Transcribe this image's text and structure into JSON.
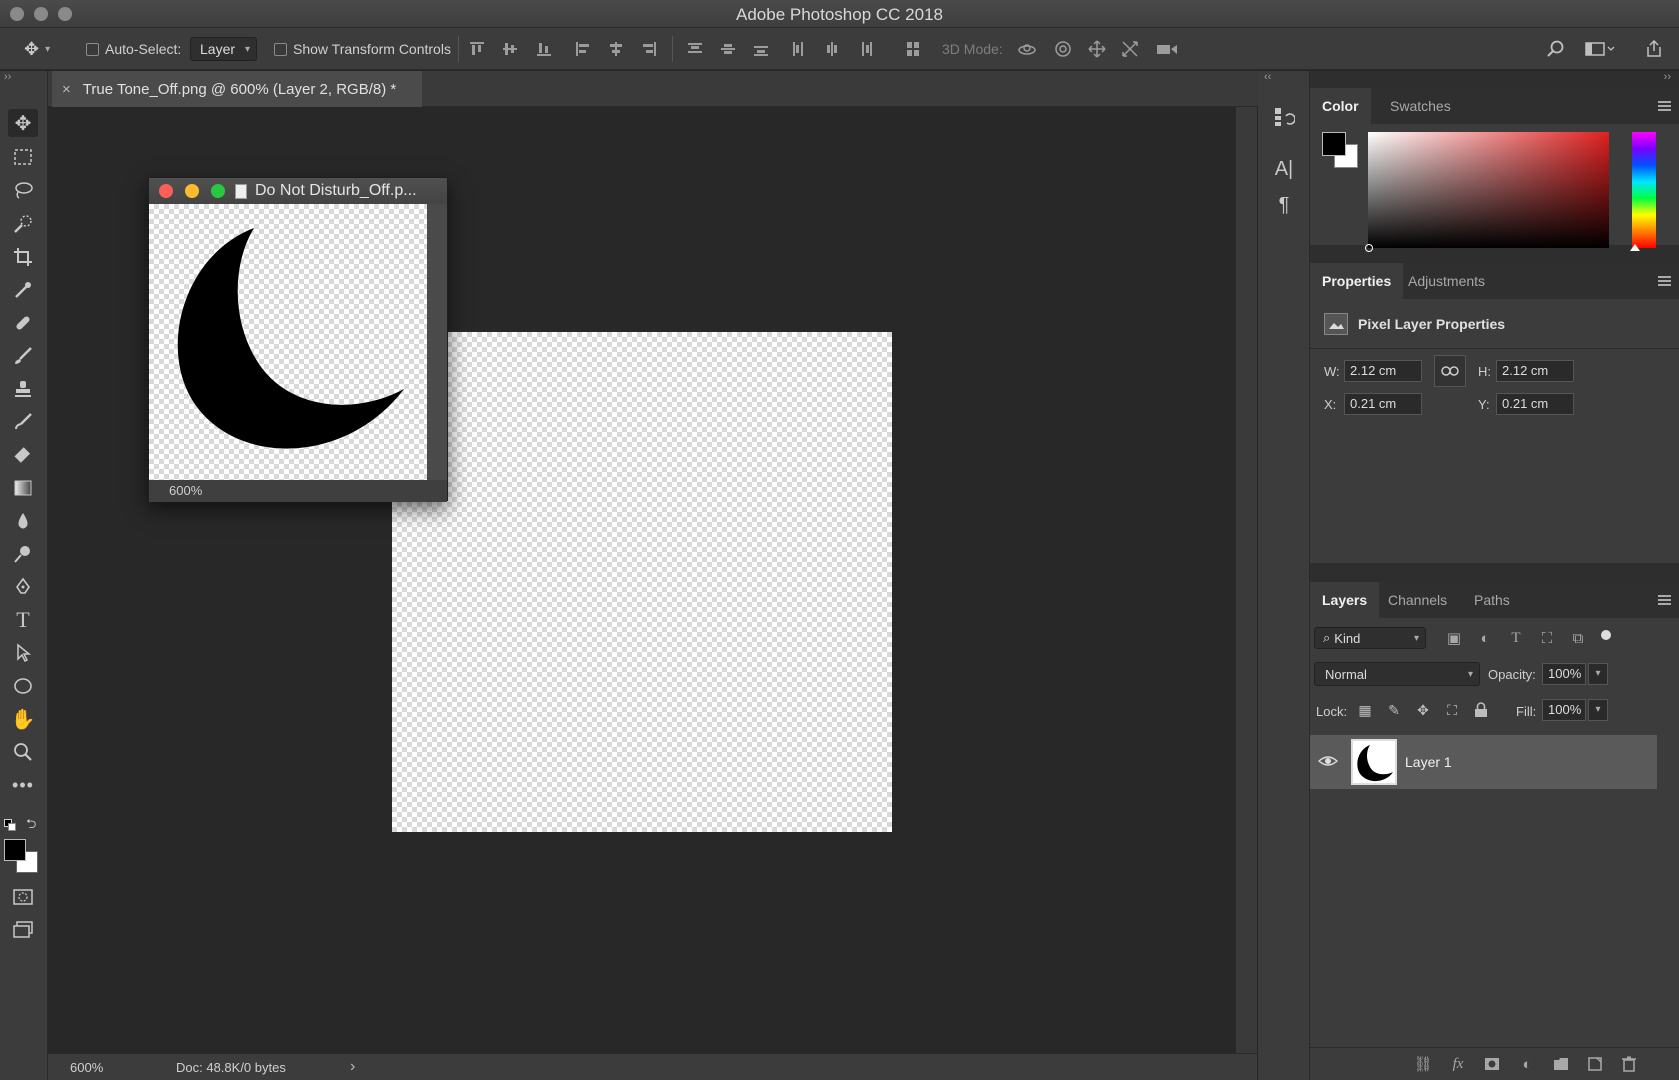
{
  "window": {
    "title": "Adobe Photoshop CC 2018"
  },
  "options_bar": {
    "auto_select_label": "Auto-Select:",
    "auto_select_value": "Layer",
    "show_transform_controls_label": "Show Transform Controls",
    "mode_3d_label": "3D Mode:"
  },
  "document": {
    "tab_title": "True Tone_Off.png @ 600% (Layer 2, RGB/8) *",
    "close_glyph": "×"
  },
  "floating_window": {
    "title": "Do Not Disturb_Off.p...",
    "zoom": "600%"
  },
  "status_bar": {
    "zoom": "600%",
    "doc_info": "Doc: 48.8K/0 bytes",
    "arrow": "›"
  },
  "color_panel": {
    "tabs": [
      "Color",
      "Swatches"
    ],
    "foreground": "#000000",
    "background": "#ffffff",
    "hue": "#e02020"
  },
  "properties_panel": {
    "tabs": [
      "Properties",
      "Adjustments"
    ],
    "heading": "Pixel Layer Properties",
    "w_label": "W:",
    "w_value": "2.12 cm",
    "h_label": "H:",
    "h_value": "2.12 cm",
    "x_label": "X:",
    "x_value": "0.21 cm",
    "y_label": "Y:",
    "y_value": "0.21 cm"
  },
  "layers_panel": {
    "tabs": [
      "Layers",
      "Channels",
      "Paths"
    ],
    "filter_kind": "Kind",
    "blend_mode": "Normal",
    "opacity_label": "Opacity:",
    "opacity_value": "100%",
    "lock_label": "Lock:",
    "fill_label": "Fill:",
    "fill_value": "100%",
    "layers": [
      {
        "name": "Layer 1",
        "visible": true
      }
    ],
    "footer_fx": "fx"
  }
}
